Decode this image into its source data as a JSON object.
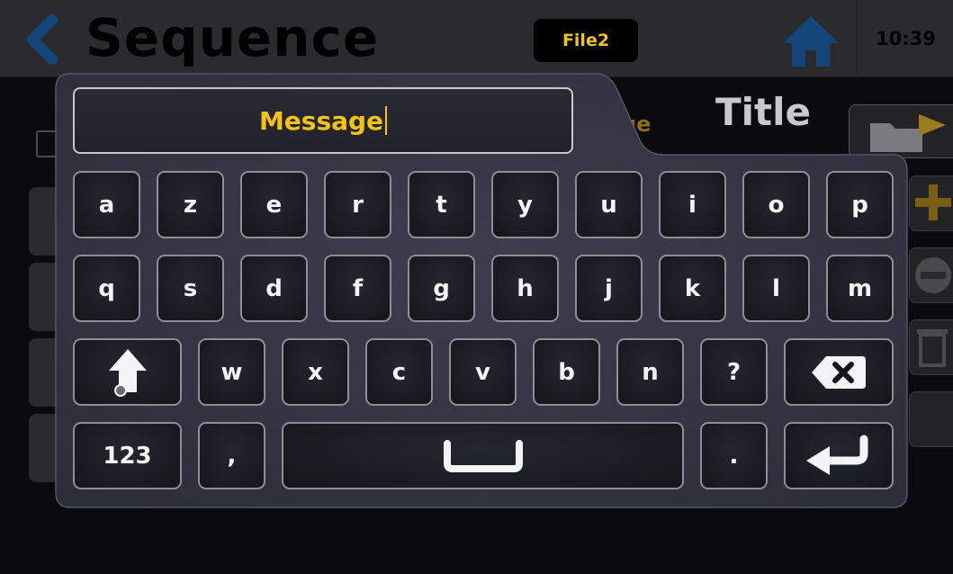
{
  "header": {
    "back_icon": "chevron-left-icon",
    "title": "Sequence",
    "file_name": "File2",
    "home_icon": "home-icon",
    "time": "10:39"
  },
  "background": {
    "message_partial": "ge",
    "title_label": "Title",
    "folder_icon": "folder-export-icon",
    "add_icon": "plus-icon",
    "remove_icon": "minus-icon",
    "delete_icon": "trash-icon"
  },
  "keyboard": {
    "text_value": "Message",
    "row1": [
      "a",
      "z",
      "e",
      "r",
      "t",
      "y",
      "u",
      "i",
      "o",
      "p"
    ],
    "row2": [
      "q",
      "s",
      "d",
      "f",
      "g",
      "h",
      "j",
      "k",
      "l",
      "m"
    ],
    "row3": [
      "w",
      "x",
      "c",
      "v",
      "b",
      "n",
      "?"
    ],
    "numbers_label": "123",
    "comma_label": ",",
    "period_label": ".",
    "shift_icon": "shift-arrow-icon",
    "backspace_icon": "backspace-icon",
    "space_icon": "space-bar-icon",
    "enter_icon": "enter-return-icon",
    "colors": {
      "accent": "#f3c316",
      "key_border": "#8e8e96",
      "panel": "#3a3a48"
    }
  }
}
